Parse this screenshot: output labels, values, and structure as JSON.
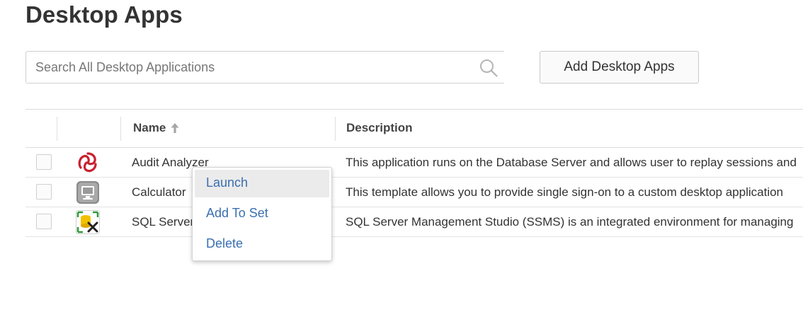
{
  "page": {
    "title": "Desktop Apps"
  },
  "search": {
    "placeholder": "Search All Desktop Applications",
    "value": ""
  },
  "toolbar": {
    "add_label": "Add Desktop Apps"
  },
  "table": {
    "columns": {
      "name": "Name",
      "description": "Description"
    },
    "sort": {
      "column": "Name",
      "direction": "ascending"
    },
    "rows": [
      {
        "name": "Audit Analyzer",
        "description": "This application runs on the Database Server and allows user to replay sessions and",
        "icon": "audit-analyzer-logo-icon",
        "checked": false
      },
      {
        "name": "Calculator",
        "description": "This template allows you to provide single sign-on to a custom desktop application",
        "icon": "monitor-icon",
        "checked": false
      },
      {
        "name": "SQL Server",
        "description": "SQL Server Management Studio (SSMS) is an integrated environment for managing",
        "icon": "database-tools-icon",
        "checked": false
      }
    ]
  },
  "context_menu": {
    "items": [
      {
        "label": "Launch",
        "highlighted": true
      },
      {
        "label": "Add To Set",
        "highlighted": false
      },
      {
        "label": "Delete",
        "highlighted": false
      }
    ]
  },
  "colors": {
    "menu_text": "#3a6fb0",
    "audit_logo": "#c8202e",
    "monitor_gray": "#8a8a8a",
    "db_yellow": "#f2c100",
    "db_green": "#2f9a3a"
  }
}
